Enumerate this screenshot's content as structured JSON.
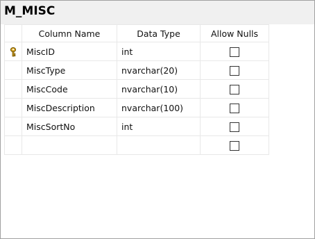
{
  "table": {
    "title": "M_MISC",
    "columns": {
      "name": "Column Name",
      "type": "Data Type",
      "nulls": "Allow Nulls"
    },
    "rows": [
      {
        "name": "MiscID",
        "type": "int",
        "allow_nulls": false,
        "primary_key": true
      },
      {
        "name": "MiscType",
        "type": "nvarchar(20)",
        "allow_nulls": false,
        "primary_key": false
      },
      {
        "name": "MiscCode",
        "type": "nvarchar(10)",
        "allow_nulls": false,
        "primary_key": false
      },
      {
        "name": "MiscDescription",
        "type": "nvarchar(100)",
        "allow_nulls": false,
        "primary_key": false
      },
      {
        "name": "MiscSortNo",
        "type": "int",
        "allow_nulls": false,
        "primary_key": false
      },
      {
        "name": "",
        "type": "",
        "allow_nulls": false,
        "primary_key": false
      }
    ]
  },
  "icons": {
    "primary_key": "key-icon",
    "checkbox": "checkbox-unchecked"
  },
  "colors": {
    "title_bar": "#f0f0f0",
    "grid_line": "#e8e8e8",
    "key_gold": "#d4a017"
  }
}
